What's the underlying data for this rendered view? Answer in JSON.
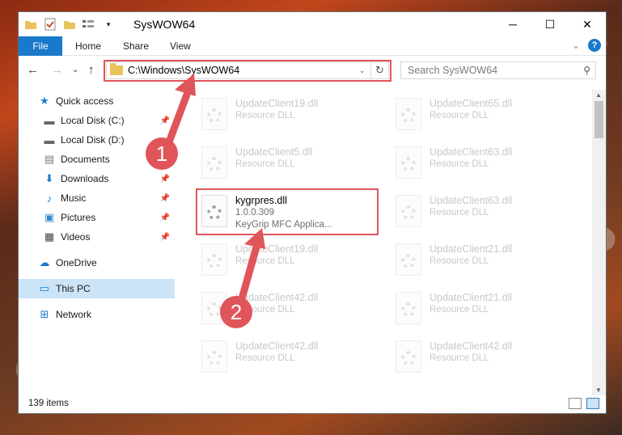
{
  "window": {
    "title": "SysWOW64",
    "controls": {
      "minimize": "─",
      "maximize": "☐",
      "close": "✕"
    }
  },
  "ribbon": {
    "tabs": [
      "File",
      "Home",
      "Share",
      "View"
    ],
    "expand_glyph": "⌄",
    "help_glyph": "?"
  },
  "address_bar": {
    "path": "C:\\Windows\\SysWOW64",
    "dropdown_glyph": "⌄",
    "refresh_glyph": "↻"
  },
  "search": {
    "placeholder": "Search SysWOW64",
    "icon": "⚲"
  },
  "nav": {
    "back": "←",
    "forward": "→",
    "recent": "⌄",
    "up": "↑",
    "items": [
      {
        "label": "Quick access",
        "icon": "star-icon",
        "glyph": "★",
        "pinned": false
      },
      {
        "label": "Local Disk (C:)",
        "icon": "drive-icon",
        "glyph": "▬",
        "pinned": true
      },
      {
        "label": "Local Disk (D:)",
        "icon": "drive-icon",
        "glyph": "▬",
        "pinned": false
      },
      {
        "label": "Documents",
        "icon": "documents-icon",
        "glyph": "▤",
        "pinned": true
      },
      {
        "label": "Downloads",
        "icon": "downloads-icon",
        "glyph": "⬇",
        "pinned": true
      },
      {
        "label": "Music",
        "icon": "music-icon",
        "glyph": "♪",
        "pinned": true
      },
      {
        "label": "Pictures",
        "icon": "pictures-icon",
        "glyph": "▣",
        "pinned": true
      },
      {
        "label": "Videos",
        "icon": "videos-icon",
        "glyph": "▦",
        "pinned": true
      },
      {
        "label": "OneDrive",
        "icon": "cloud-icon",
        "glyph": "☁",
        "pinned": false
      },
      {
        "label": "This PC",
        "icon": "computer-icon",
        "glyph": "▭",
        "pinned": false
      },
      {
        "label": "Network",
        "icon": "network-icon",
        "glyph": "⊞",
        "pinned": false
      }
    ],
    "pin_glyph": "📌"
  },
  "files": {
    "left": [
      {
        "name": "UpdateClient19.dll",
        "type": "Resource DLL"
      },
      {
        "name": "UpdateClient5.dll",
        "type": "Resource DLL"
      },
      {
        "name": "kygrpres.dll",
        "type": "1.0.0.309",
        "desc": "KeyGrip MFC Applica..."
      },
      {
        "name": "UpdateClient19.dll",
        "type": "Resource DLL"
      },
      {
        "name": "UpdateClient42.dll",
        "type": "Resource DLL"
      },
      {
        "name": "UpdateClient42.dll",
        "type": "Resource DLL"
      }
    ],
    "right": [
      {
        "name": "UpdateClient65.dll",
        "type": "Resource DLL"
      },
      {
        "name": "UpdateClient63.dll",
        "type": "Resource DLL"
      },
      {
        "name": "UpdateClient63.dll",
        "type": "Resource DLL"
      },
      {
        "name": "UpdateClient21.dll",
        "type": "Resource DLL"
      },
      {
        "name": "UpdateClient21.dll",
        "type": "Resource DLL"
      },
      {
        "name": "UpdateClient42.dll",
        "type": "Resource DLL"
      }
    ]
  },
  "status": {
    "item_count": "139 items"
  },
  "annotations": {
    "step1": "1",
    "step2": "2"
  },
  "colors": {
    "accent": "#1979ca",
    "highlight": "#e0555a",
    "selected": "#cce4f7"
  }
}
